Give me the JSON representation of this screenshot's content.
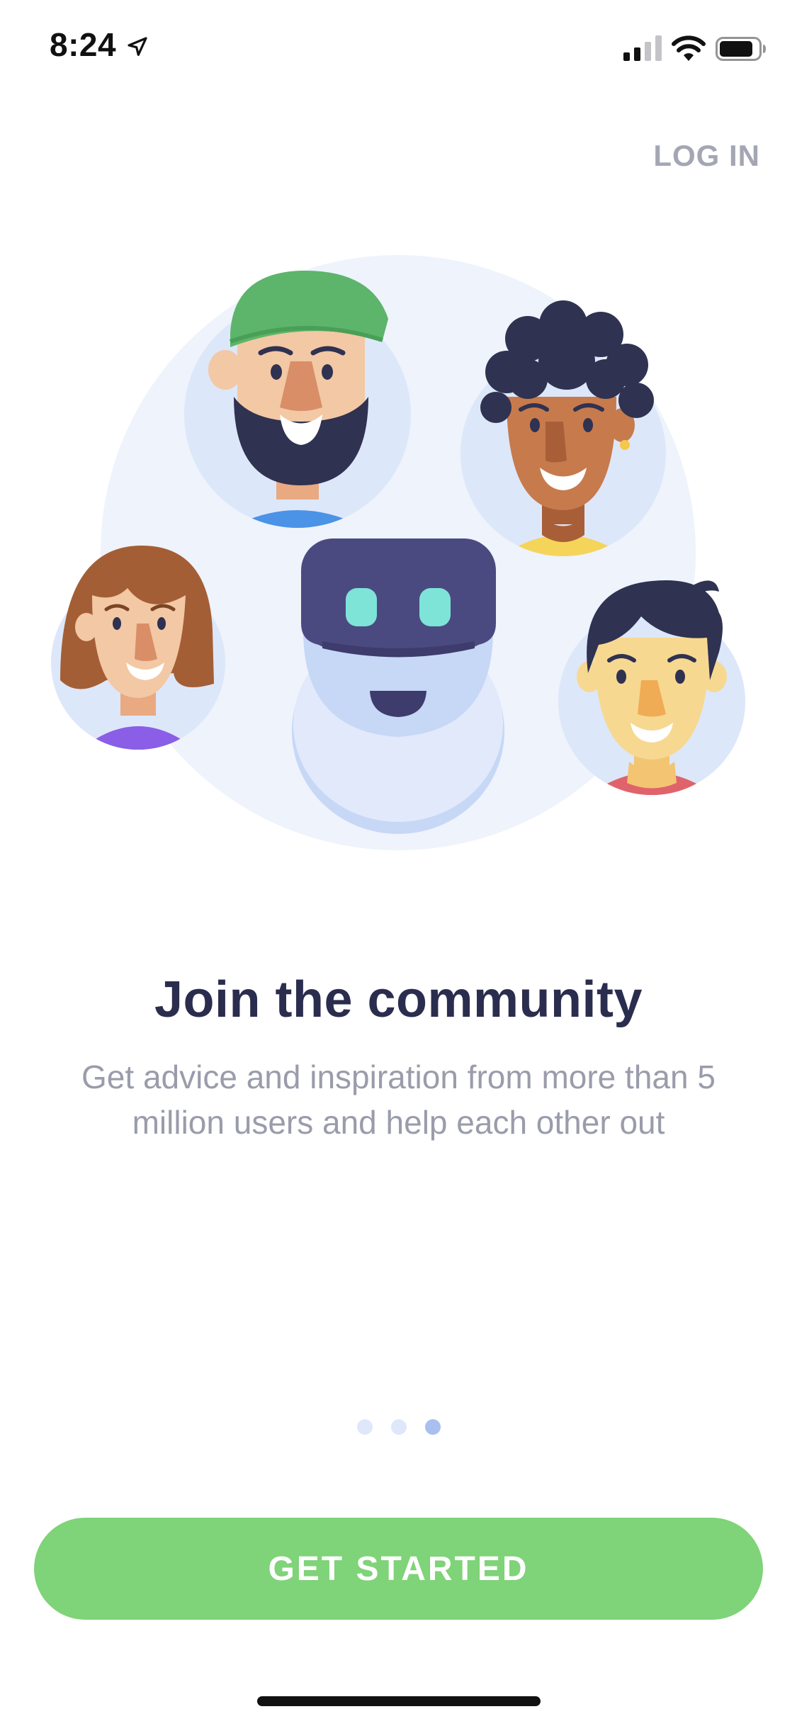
{
  "status_bar": {
    "time": "8:24",
    "icons": [
      "location-arrow-icon",
      "cellular-signal-icon",
      "wifi-icon",
      "battery-icon"
    ]
  },
  "header": {
    "login_label": "LOG IN"
  },
  "onboarding": {
    "title": "Join the community",
    "description": "Get advice and inspiration from more than 5 million users and help each other out",
    "illustration_icons": [
      "bearded-man-avatar",
      "curly-hair-woman-avatar",
      "long-hair-woman-avatar",
      "robot-mascot",
      "short-hair-man-avatar"
    ]
  },
  "pagination": {
    "total_pages": 3,
    "current_page": 3
  },
  "cta": {
    "label": "GET STARTED"
  },
  "colors": {
    "accent_green": "#7fd378",
    "title_navy": "#2b2d4e",
    "body_gray": "#9a9cab",
    "login_gray": "#a4a6b4",
    "dot_inactive": "#dfe8fa",
    "dot_active": "#a9bff0",
    "illustration_bg": "#eef3fc"
  }
}
